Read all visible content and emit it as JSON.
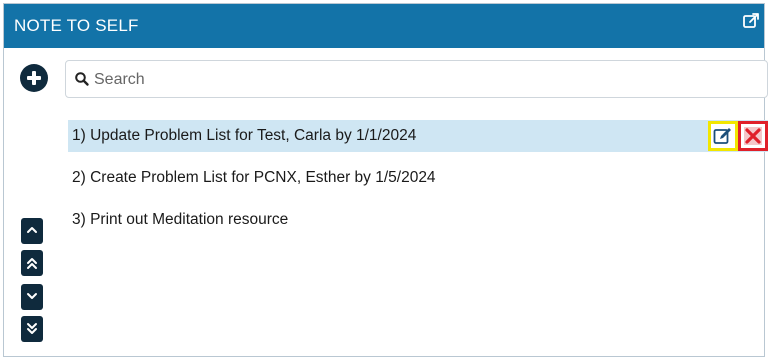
{
  "header": {
    "title": "NOTE TO SELF",
    "popout_icon": "external-link-icon"
  },
  "toolbar": {
    "add_icon": "plus-circle-icon"
  },
  "search": {
    "placeholder": "Search",
    "value": "",
    "icon": "search-icon"
  },
  "notes": [
    {
      "label": "1) Update Problem List for Test, Carla by 1/1/2024",
      "selected": true
    },
    {
      "label": "2) Create Problem List for PCNX, Esther by 1/5/2024",
      "selected": false
    },
    {
      "label": "3) Print out Meditation resource",
      "selected": false
    }
  ],
  "row_actions": {
    "edit_icon": "edit-icon",
    "delete_icon": "delete-icon",
    "edit_highlight": "#f2e600",
    "delete_highlight": "#e0202a"
  },
  "move_buttons": [
    {
      "icon": "chevron-up-icon"
    },
    {
      "icon": "double-chevron-up-icon"
    },
    {
      "icon": "chevron-down-icon"
    },
    {
      "icon": "double-chevron-down-icon"
    }
  ],
  "colors": {
    "header_bg": "#1373a8",
    "selected_row_bg": "#cfe6f3",
    "dark_button": "#0f2a3d"
  }
}
